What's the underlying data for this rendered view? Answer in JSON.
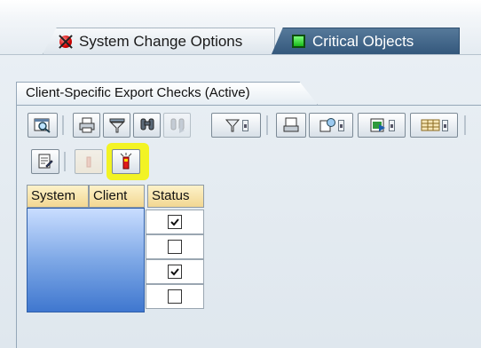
{
  "tabs": [
    {
      "label": "System Change Options",
      "icon": "red-status-icon",
      "active": false
    },
    {
      "label": "Critical Objects",
      "icon": "green-status-icon",
      "active": true
    }
  ],
  "group": {
    "title": "Client-Specific Export Checks (Active)"
  },
  "toolbar": {
    "row1_icons": [
      "details-icon",
      "print-icon",
      "filter-icon",
      "find-icon",
      "find-next-icon",
      "set-filter-icon",
      "print-preview-icon",
      "export-icon",
      "views-icon",
      "layout-icon"
    ],
    "row2_icons": [
      "display-change-icon",
      "warning-light-icon",
      "active-light-icon"
    ]
  },
  "table": {
    "columns": [
      "System",
      "Client",
      "Status"
    ],
    "rows": [
      {
        "checked": true
      },
      {
        "checked": false
      },
      {
        "checked": true
      },
      {
        "checked": false
      }
    ]
  },
  "colors": {
    "highlight": "#f5f500",
    "tab_active": "#3f6388",
    "selection": "#5c8fdc"
  }
}
